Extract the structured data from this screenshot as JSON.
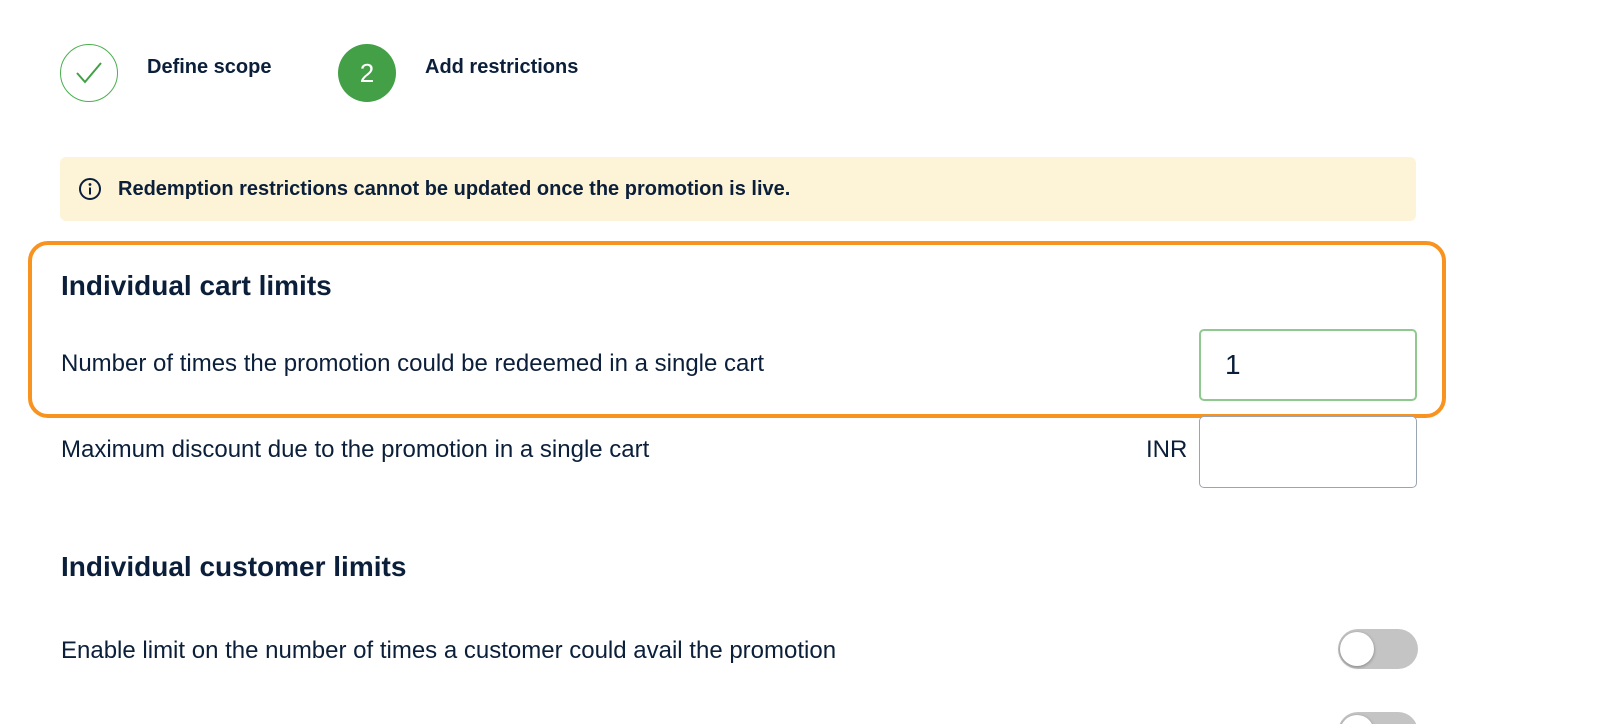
{
  "stepper": {
    "steps": [
      {
        "label": "Define scope",
        "status": "completed"
      },
      {
        "number": "2",
        "label": "Add restrictions",
        "status": "active"
      }
    ]
  },
  "banner": {
    "icon": "info-icon",
    "text": "Redemption restrictions cannot be updated once the promotion is live.",
    "background": "#fdf3d6"
  },
  "cart_limits": {
    "title": "Individual cart limits",
    "redemptions_label": "Number of times the promotion could be redeemed in a single cart",
    "redemptions_value": "1",
    "max_discount_label": "Maximum discount due to the promotion in a single cart",
    "max_discount_currency": "INR",
    "max_discount_value": ""
  },
  "customer_limits": {
    "title": "Individual customer limits",
    "limit_toggle_label": "Enable limit on the number of times a customer could avail the promotion",
    "limit_toggle_on": false,
    "second_toggle_on": false
  },
  "colors": {
    "accent_green": "#43a047",
    "highlight_orange": "#f7931e",
    "text": "#0b1f3a"
  }
}
